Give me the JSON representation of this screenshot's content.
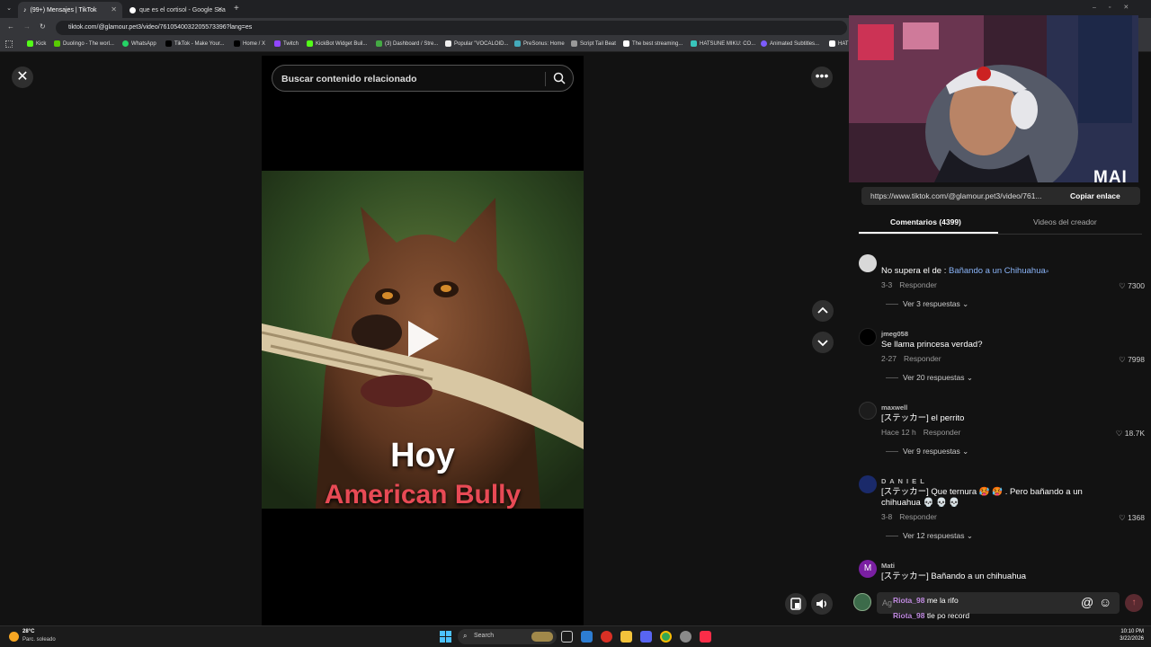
{
  "browser": {
    "tabs": [
      {
        "label": "(99+) Mensajes | TikTok",
        "active": true
      },
      {
        "label": "que es el cortisol - Google Sea",
        "active": false
      }
    ],
    "url": "tiktok.com/@glamour.pet3/video/7610540032205573396?lang=es",
    "bookmarks": [
      "Kick",
      "Duolingo - The worl...",
      "WhatsApp",
      "TikTok - Make Your...",
      "Home / X",
      "Twitch",
      "KickBot Widget Buil...",
      "(3) Dashboard / Stre...",
      "Popular \"VOCALOID...",
      "PreSonus: Home",
      "Script Tail Beat",
      "The best streaming...",
      "HATSUNE MIKU: CO...",
      "Animated Subtitles...",
      "HAT"
    ]
  },
  "video": {
    "search_placeholder": "Buscar contenido relacionado",
    "overlay_line1": "Hoy",
    "overlay_line2": "American Bully"
  },
  "webcam": {
    "watermark": "MAI"
  },
  "panel": {
    "share_url": "https://www.tiktok.com/@glamour.pet3/video/761...",
    "copy_label": "Copiar enlace",
    "tab_comments": "Comentarios (4399)",
    "tab_creator": "Videos del creador"
  },
  "comments": [
    {
      "name": "",
      "prefix": "No supera el de : ",
      "link": "Bañando a un Chihuahua",
      "text": "",
      "date": "3-3",
      "reply": "Responder",
      "likes": "7300",
      "replies": "Ver 3 respuestas",
      "avatar_color": "#d8d8d8"
    },
    {
      "name": "jmeg058",
      "text": "Se llama princesa verdad?",
      "date": "2-27",
      "reply": "Responder",
      "likes": "7998",
      "replies": "Ver 20 respuestas",
      "avatar_color": "#000000"
    },
    {
      "name": "maxwell",
      "text": "[ステッカー] el perrito",
      "date": "Hace 12 h",
      "reply": "Responder",
      "likes": "18.7K",
      "replies": "Ver 9 respuestas",
      "avatar_color": "#1c1c1c"
    },
    {
      "name": "D A N I E L",
      "text": "[ステッカー] Que ternura 🥵 🥵 . Pero bañando a un chihuahua 💀 💀 💀",
      "date": "3-8",
      "reply": "Responder",
      "likes": "1368",
      "replies": "Ver 12 respuestas",
      "avatar_color": "#1a2a6a"
    },
    {
      "name": "Mati",
      "text": "[ステッカー] Bañando a un chihuahua",
      "avatar_letter": "M",
      "avatar_color": "#7a1fa2"
    }
  ],
  "comment_input": {
    "placeholder": "Ag"
  },
  "chat_overlay": [
    {
      "user": "Riota_98",
      "message": "me la rifo"
    },
    {
      "user": "Riota_98",
      "message": "tle po record"
    }
  ],
  "taskbar": {
    "weather_temp": "28°C",
    "weather_desc": "Parc. soleado",
    "search_label": "Search",
    "time": "10:10 PM",
    "date": "3/22/2026"
  }
}
